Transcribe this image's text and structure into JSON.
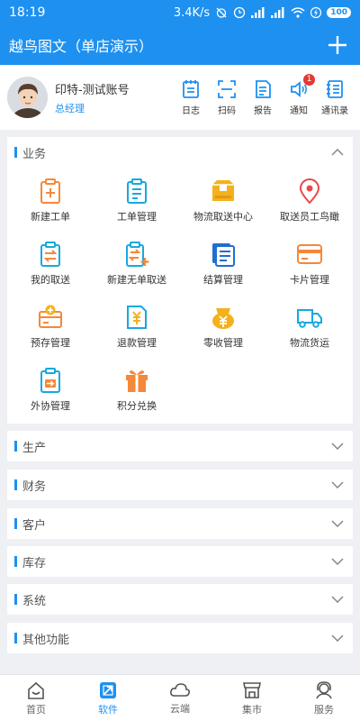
{
  "status_bar": {
    "time": "18:19",
    "speed": "3.4K/s",
    "battery": "100"
  },
  "app_bar": {
    "title": "越鸟图文（单店演示）"
  },
  "profile": {
    "name": "印特-测试账号",
    "role": "总经理"
  },
  "quick_actions": [
    {
      "label": "日志",
      "icon": "journal-icon"
    },
    {
      "label": "扫码",
      "icon": "scan-icon"
    },
    {
      "label": "报告",
      "icon": "report-icon"
    },
    {
      "label": "通知",
      "icon": "notification-icon",
      "badge": "1"
    },
    {
      "label": "通讯录",
      "icon": "contacts-icon"
    }
  ],
  "business": {
    "title": "业务",
    "items": [
      {
        "label": "新建工单",
        "icon": "new-order-icon"
      },
      {
        "label": "工单管理",
        "icon": "order-management-icon"
      },
      {
        "label": "物流取送中心",
        "icon": "logistics-box-icon"
      },
      {
        "label": "取送员工鸟瞰",
        "icon": "map-pin-icon"
      },
      {
        "label": "我的取送",
        "icon": "my-delivery-icon"
      },
      {
        "label": "新建无单取送",
        "icon": "new-delivery-icon"
      },
      {
        "label": "结算管理",
        "icon": "settlement-icon"
      },
      {
        "label": "卡片管理",
        "icon": "card-icon"
      },
      {
        "label": "预存管理",
        "icon": "prepaid-icon"
      },
      {
        "label": "退款管理",
        "icon": "refund-icon"
      },
      {
        "label": "零收管理",
        "icon": "coin-purse-icon"
      },
      {
        "label": "物流货运",
        "icon": "truck-icon"
      },
      {
        "label": "外协管理",
        "icon": "outsourcing-icon"
      },
      {
        "label": "积分兑换",
        "icon": "gift-icon"
      }
    ]
  },
  "sections": [
    {
      "title": "生产"
    },
    {
      "title": "财务"
    },
    {
      "title": "客户"
    },
    {
      "title": "库存"
    },
    {
      "title": "系统"
    },
    {
      "title": "其他功能"
    }
  ],
  "tabs": [
    {
      "label": "首页",
      "icon": "home-icon"
    },
    {
      "label": "软件",
      "icon": "software-icon",
      "active": true
    },
    {
      "label": "云端",
      "icon": "cloud-icon"
    },
    {
      "label": "集市",
      "icon": "market-icon"
    },
    {
      "label": "服务",
      "icon": "service-icon"
    }
  ],
  "colors": {
    "brand": "#1e90f0",
    "orange": "#f5883a",
    "cyan": "#18a8e0",
    "yellow": "#f3b21c",
    "red": "#e8494a"
  }
}
